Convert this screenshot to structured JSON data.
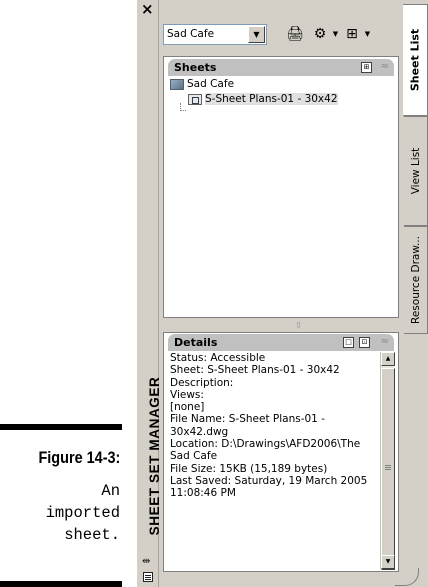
{
  "figure": {
    "label": "Figure 14-3:",
    "caption_lines": [
      "An",
      "imported",
      "sheet."
    ]
  },
  "palette": {
    "title": "SHEET SET MANAGER",
    "close_glyph": "×",
    "sheet_set_select": {
      "value": "Sad Cafe"
    },
    "toolbar_icons": [
      "publish-icon",
      "publish-dropdown-icon",
      "view-dropdown-icon"
    ],
    "sheets_panel": {
      "title": "Sheets",
      "tree": [
        {
          "label": "Sad Cafe",
          "type": "sheet-set"
        },
        {
          "label": "S-Sheet Plans-01 - 30x42",
          "type": "sheet",
          "selected": true
        }
      ]
    },
    "details_panel": {
      "title": "Details",
      "lines": [
        "Status: Accessible",
        "Sheet: S-Sheet Plans-01 - 30x42",
        "Description:",
        "",
        "Views:",
        "[none]",
        "",
        "",
        "File Name: S-Sheet Plans-01 -",
        "30x42.dwg",
        "Location: D:\\Drawings\\AFD2006\\The",
        "Sad Cafe",
        "File Size: 15KB (15,189 bytes)",
        "Last Saved: Saturday, 19 March 2005",
        "11:08:46 PM"
      ]
    },
    "tabs": [
      {
        "label": "Sheet List",
        "active": true
      },
      {
        "label": "View List",
        "active": false
      },
      {
        "label": "Resource Draw...",
        "active": false
      }
    ]
  }
}
